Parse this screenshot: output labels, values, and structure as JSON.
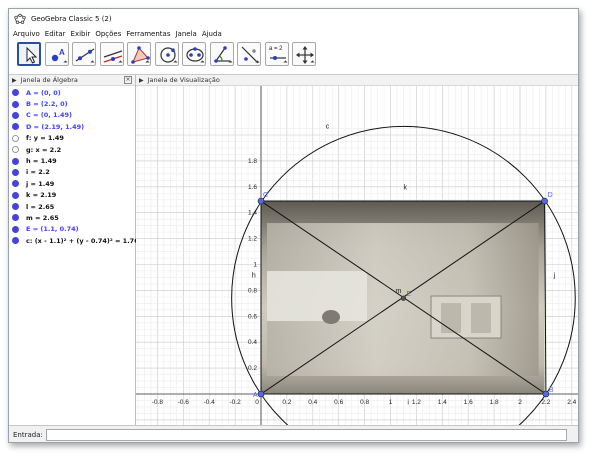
{
  "window": {
    "title": "GeoGebra Classic 5 (2)",
    "icon": "geogebra-logo-icon"
  },
  "menu": [
    "Arquivo",
    "Editar",
    "Exibir",
    "Opções",
    "Ferramentas",
    "Janela",
    "Ajuda"
  ],
  "toolbar": {
    "tools": [
      {
        "name": "move-tool",
        "icon": "arrow-pointer-icon"
      },
      {
        "name": "point-tool",
        "icon": "point-icon"
      },
      {
        "name": "line-tool",
        "icon": "line-through-points-icon"
      },
      {
        "name": "perpendicular-tool",
        "icon": "perpendicular-line-icon"
      },
      {
        "name": "polygon-tool",
        "icon": "polygon-icon"
      },
      {
        "name": "circle-tool",
        "icon": "circle-center-point-icon"
      },
      {
        "name": "ellipse-tool",
        "icon": "ellipse-icon"
      },
      {
        "name": "angle-tool",
        "icon": "angle-icon"
      },
      {
        "name": "reflect-tool",
        "icon": "reflect-about-line-icon"
      },
      {
        "name": "slider-tool",
        "icon": "slider-icon",
        "label": "a = 2"
      },
      {
        "name": "move-graphics-tool",
        "icon": "move-graphics-view-icon"
      }
    ],
    "selected": "move-tool"
  },
  "algebra_view": {
    "title": "Janela de Álgebra",
    "items": [
      {
        "text": "A = (0, 0)",
        "color": "#4040ff",
        "dot": "#4444dd"
      },
      {
        "text": "B = (2.2, 0)",
        "color": "#4040ff",
        "dot": "#4444dd"
      },
      {
        "text": "C = (0, 1.49)",
        "color": "#4040ff",
        "dot": "#4444dd"
      },
      {
        "text": "D = (2.19, 1.49)",
        "color": "#4040ff",
        "dot": "#4444dd"
      },
      {
        "text": "f: y = 1.49",
        "color": "#111111",
        "dot": "hollow"
      },
      {
        "text": "g: x = 2.2",
        "color": "#111111",
        "dot": "hollow"
      },
      {
        "text": "h = 1.49",
        "color": "#111111",
        "dot": "#4444dd"
      },
      {
        "text": "i = 2.2",
        "color": "#111111",
        "dot": "#4444dd"
      },
      {
        "text": "j = 1.49",
        "color": "#111111",
        "dot": "#4444dd"
      },
      {
        "text": "k = 2.19",
        "color": "#111111",
        "dot": "#4444dd"
      },
      {
        "text": "l = 2.65",
        "color": "#111111",
        "dot": "#4444dd"
      },
      {
        "text": "m = 2.65",
        "color": "#111111",
        "dot": "#4444dd"
      },
      {
        "text": "E = (1.1, 0.74)",
        "color": "#4040ff",
        "dot": "#4444dd"
      },
      {
        "text": "c: (x - 1.1)² + (y - 0.74)² = 1.76",
        "color": "#111111",
        "dot": "#4444dd"
      }
    ]
  },
  "graphics_view": {
    "title": "Janela de Visualização",
    "x_ticks": [
      "-0.8",
      "-0.6",
      "-0.4",
      "-0.2",
      "0",
      "0.2",
      "0.4",
      "0.6",
      "0.8",
      "1",
      "1.2",
      "1.4",
      "1.6",
      "1.8",
      "2",
      "2.2",
      "2.4"
    ],
    "y_ticks": [
      "0.2",
      "0.4",
      "0.6",
      "0.8",
      "1",
      "1.2",
      "1.4",
      "1.6",
      "1.8"
    ],
    "points": [
      {
        "label": "A",
        "x": 0,
        "y": 0
      },
      {
        "label": "B",
        "x": 2.2,
        "y": 0
      },
      {
        "label": "C",
        "x": 0,
        "y": 1.49
      },
      {
        "label": "D",
        "x": 2.19,
        "y": 1.49
      },
      {
        "label": "E",
        "x": 1.1,
        "y": 0.74
      }
    ],
    "object_labels": [
      "c",
      "k",
      "h",
      "j",
      "m",
      "i"
    ],
    "circle": {
      "cx": 1.1,
      "cy": 0.74,
      "r2": 1.76
    },
    "point_color": "#5566ee",
    "background_image": "photo-of-sink-counter"
  },
  "input_bar": {
    "label": "Entrada:",
    "value": ""
  }
}
